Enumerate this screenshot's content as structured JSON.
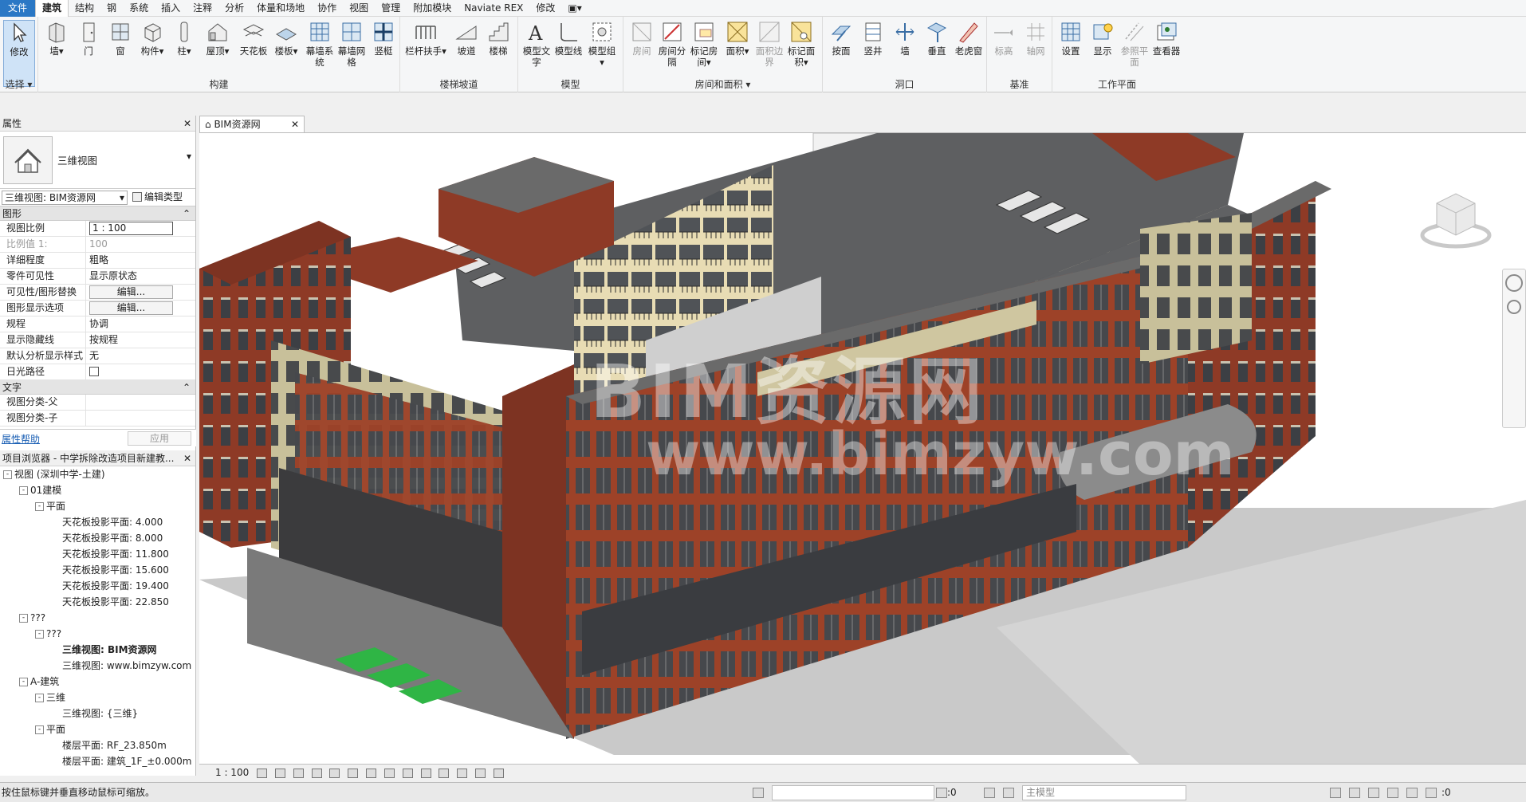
{
  "menu": {
    "tabs": [
      "文件",
      "建筑",
      "结构",
      "钢",
      "系统",
      "插入",
      "注释",
      "分析",
      "体量和场地",
      "协作",
      "视图",
      "管理",
      "附加模块",
      "Naviate REX",
      "修改"
    ],
    "active": "建筑"
  },
  "ribbon": {
    "groups": {
      "select": "选择",
      "build": "构建",
      "stairs": "楼梯坡道",
      "model": "模型",
      "room": "房间和面积",
      "opening": "洞口",
      "datum": "基准",
      "workplane": "工作平面"
    },
    "tools": {
      "modify": "修改",
      "wall": "墙",
      "door": "门",
      "window": "窗",
      "component": "构件",
      "column": "柱",
      "roof": "屋顶",
      "ceiling": "天花板",
      "floor": "楼板",
      "curtain_system": "幕墙系统",
      "curtain_grid": "幕墙网格",
      "mullion": "竖梃",
      "railing": "栏杆扶手",
      "ramp": "坡道",
      "stair": "楼梯",
      "model_text": "模型文字",
      "model_line": "模型线",
      "model_group": "模型组",
      "room": "房间",
      "room_separator": "房间分隔",
      "tag_room": "标记房间",
      "area": "面积",
      "area_boundary": "面积边界",
      "tag_area": "标记面积",
      "by_face": "按面",
      "shaft": "竖井",
      "wall_opening": "墙",
      "vertical": "垂直",
      "dormer": "老虎窗",
      "level": "标高",
      "grid": "轴网",
      "set": "设置",
      "show": "显示",
      "ref_plane": "参照平面",
      "viewer": "查看器"
    }
  },
  "properties": {
    "title": "属性",
    "type_name": "三维视图",
    "view_selector": "三维视图: BIM资源网",
    "edit_type": "编辑类型",
    "section_graphics": "图形",
    "rows": [
      {
        "k": "视图比例",
        "v": "1 : 100"
      },
      {
        "k": "比例值 1:",
        "v": "100"
      },
      {
        "k": "详细程度",
        "v": "粗略"
      },
      {
        "k": "零件可见性",
        "v": "显示原状态"
      },
      {
        "k": "可见性/图形替换",
        "v": "编辑..."
      },
      {
        "k": "图形显示选项",
        "v": "编辑..."
      },
      {
        "k": "规程",
        "v": "协调"
      },
      {
        "k": "显示隐藏线",
        "v": "按规程"
      },
      {
        "k": "默认分析显示样式",
        "v": "无"
      },
      {
        "k": "日光路径",
        "v": ""
      }
    ],
    "section_text": "文字",
    "text_rows": [
      {
        "k": "视图分类-父",
        "v": ""
      },
      {
        "k": "视图分类-子",
        "v": ""
      }
    ],
    "help": "属性帮助",
    "apply": "应用"
  },
  "browser": {
    "title": "项目浏览器 - 中学拆除改造项目新建教...",
    "items": [
      {
        "t": "视图 (深圳中学-土建)",
        "lvl": 0,
        "tg": "-"
      },
      {
        "t": "01建模",
        "lvl": 1,
        "tg": "-"
      },
      {
        "t": "平面",
        "lvl": 2,
        "tg": "-"
      },
      {
        "t": "天花板投影平面: 4.000",
        "lvl": 3
      },
      {
        "t": "天花板投影平面: 8.000",
        "lvl": 3
      },
      {
        "t": "天花板投影平面: 11.800",
        "lvl": 3
      },
      {
        "t": "天花板投影平面: 15.600",
        "lvl": 3
      },
      {
        "t": "天花板投影平面: 19.400",
        "lvl": 3
      },
      {
        "t": "天花板投影平面: 22.850",
        "lvl": 3
      },
      {
        "t": "???",
        "lvl": 1,
        "tg": "-"
      },
      {
        "t": "???",
        "lvl": 2,
        "tg": "-"
      },
      {
        "t": "三维视图: BIM资源网",
        "lvl": 3,
        "bold": true
      },
      {
        "t": "三维视图: www.bimzyw.com",
        "lvl": 3
      },
      {
        "t": "A-建筑",
        "lvl": 1,
        "tg": "-"
      },
      {
        "t": "三维",
        "lvl": 2,
        "tg": "-"
      },
      {
        "t": "三维视图: {三维}",
        "lvl": 3
      },
      {
        "t": "平面",
        "lvl": 2,
        "tg": "-"
      },
      {
        "t": "楼层平面: RF_23.850m",
        "lvl": 3
      },
      {
        "t": "楼层平面: 建筑_1F_±0.000m",
        "lvl": 3
      }
    ]
  },
  "view": {
    "tab": "BIM资源网",
    "watermark_cn": "BIM资源网",
    "watermark_en": "www.bimzyw.com",
    "scale": "1 : 100"
  },
  "status": {
    "message": "按住鼠标键并垂直移动鼠标可缩放。",
    "zero": ":0",
    "model": "主模型",
    "zero2": ":0"
  }
}
